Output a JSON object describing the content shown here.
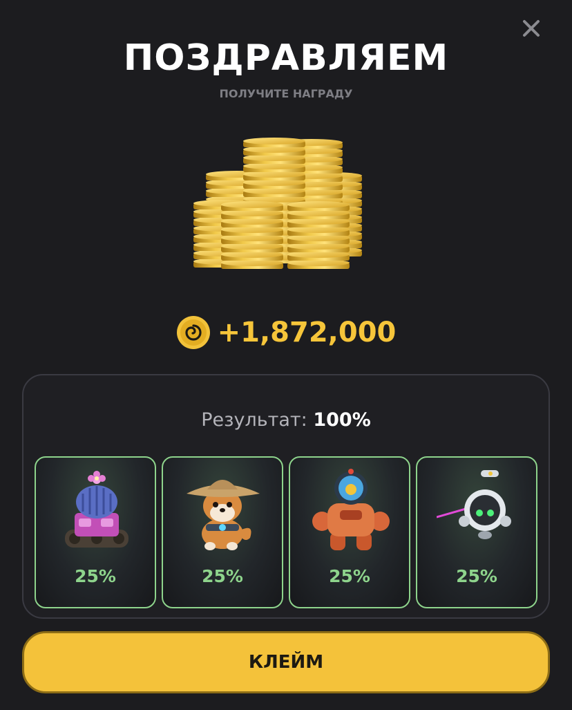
{
  "header": {
    "title": "ПОЗДРАВЛЯЕМ",
    "subtitle": "ПОЛУЧИТЕ НАГРАДУ",
    "close_icon": "close-icon"
  },
  "reward": {
    "icon": "coin-spiral-icon",
    "amount": "+1,872,000",
    "illustration": "gold-coin-stacks"
  },
  "result": {
    "label": "Результат:",
    "value": "100%"
  },
  "cards": [
    {
      "character": "cactus-tank",
      "percent": "25%"
    },
    {
      "character": "shiba-dog-straw-hat",
      "percent": "25%"
    },
    {
      "character": "orange-robot-mech",
      "percent": "25%"
    },
    {
      "character": "white-spherical-drone",
      "percent": "25%"
    }
  ],
  "claim_button": {
    "label": "КЛЕЙМ"
  },
  "colors": {
    "background": "#1c1c1f",
    "accent_yellow": "#f4c23a",
    "amount_yellow": "#f6c53a",
    "card_border_green": "#8ed48c",
    "subtitle_gray": "#7e7e84"
  }
}
